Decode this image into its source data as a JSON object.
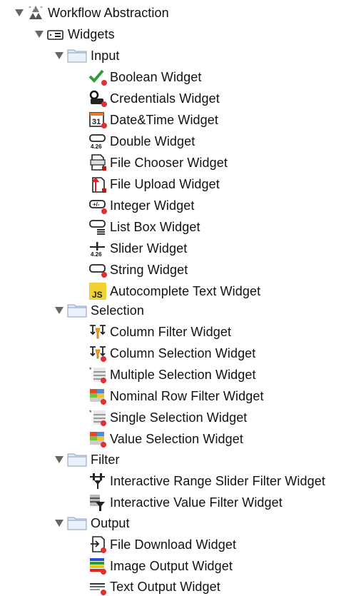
{
  "tree": {
    "root": {
      "label": "Workflow Abstraction",
      "icon": "workflow-abstraction-icon"
    },
    "widgets": {
      "label": "Widgets",
      "icon": "widgets-category-icon"
    },
    "groups": [
      {
        "label": "Input",
        "items": [
          {
            "label": "Boolean Widget",
            "icon": "checkmark-icon"
          },
          {
            "label": "Credentials Widget",
            "icon": "key-icon"
          },
          {
            "label": "Date&Time Widget",
            "icon": "calendar-icon"
          },
          {
            "label": "Double Widget",
            "icon": "double-input-icon"
          },
          {
            "label": "File Chooser Widget",
            "icon": "file-chooser-icon"
          },
          {
            "label": "File Upload Widget",
            "icon": "file-upload-icon"
          },
          {
            "label": "Integer Widget",
            "icon": "integer-input-icon"
          },
          {
            "label": "List Box Widget",
            "icon": "list-box-icon"
          },
          {
            "label": "Slider Widget",
            "icon": "slider-icon"
          },
          {
            "label": "String Widget",
            "icon": "string-input-icon"
          },
          {
            "label": "Autocomplete Text Widget",
            "icon": "javascript-icon"
          }
        ]
      },
      {
        "label": "Selection",
        "items": [
          {
            "label": "Column Filter Widget",
            "icon": "column-filter-icon"
          },
          {
            "label": "Column Selection Widget",
            "icon": "column-selection-icon"
          },
          {
            "label": "Multiple Selection Widget",
            "icon": "multiple-selection-icon"
          },
          {
            "label": "Nominal Row Filter Widget",
            "icon": "nominal-row-filter-icon"
          },
          {
            "label": "Single Selection Widget",
            "icon": "single-selection-icon"
          },
          {
            "label": "Value Selection Widget",
            "icon": "value-selection-icon"
          }
        ]
      },
      {
        "label": "Filter",
        "items": [
          {
            "label": "Interactive Range Slider Filter Widget",
            "icon": "range-slider-filter-icon"
          },
          {
            "label": "Interactive Value Filter Widget",
            "icon": "value-filter-icon"
          }
        ]
      },
      {
        "label": "Output",
        "items": [
          {
            "label": "File Download Widget",
            "icon": "file-download-icon"
          },
          {
            "label": "Image Output Widget",
            "icon": "image-output-icon"
          },
          {
            "label": "Text Output Widget",
            "icon": "text-output-icon"
          }
        ]
      }
    ]
  }
}
